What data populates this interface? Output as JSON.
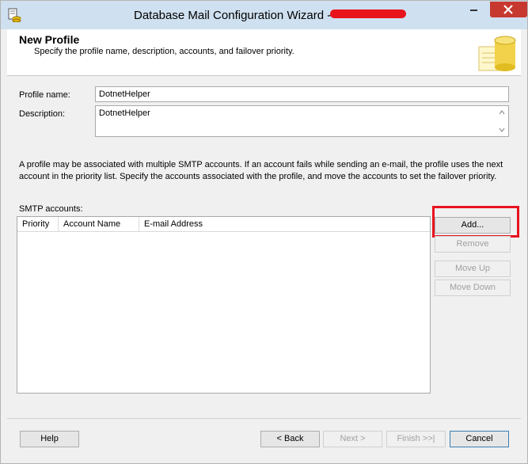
{
  "window": {
    "title": "Database Mail Configuration Wizard -",
    "app_icon": "database-mail-icon"
  },
  "header": {
    "title": "New Profile",
    "subtitle": "Specify the profile name, description, accounts, and failover priority.",
    "icon": "database-cylinder-icon"
  },
  "form": {
    "profile_name_label": "Profile name:",
    "profile_name_value": "DotnetHelper",
    "description_label": "Description:",
    "description_value": "DotnetHelper"
  },
  "info_text": "A profile may be associated with multiple SMTP accounts. If an account fails while sending an e-mail, the profile uses the next account in the priority list. Specify the accounts associated with the profile, and move the accounts to set the failover priority.",
  "smtp": {
    "label": "SMTP accounts:",
    "columns": [
      "Priority",
      "Account Name",
      "E-mail Address"
    ],
    "rows": []
  },
  "side_buttons": {
    "add": "Add...",
    "remove": "Remove",
    "move_up": "Move Up",
    "move_down": "Move Down"
  },
  "footer_buttons": {
    "help": "Help",
    "back": "< Back",
    "next": "Next >",
    "finish": "Finish >>|",
    "cancel": "Cancel"
  },
  "colors": {
    "highlight": "#e8121f",
    "redaction": "#e8141c",
    "close_button": "#c7392f"
  }
}
